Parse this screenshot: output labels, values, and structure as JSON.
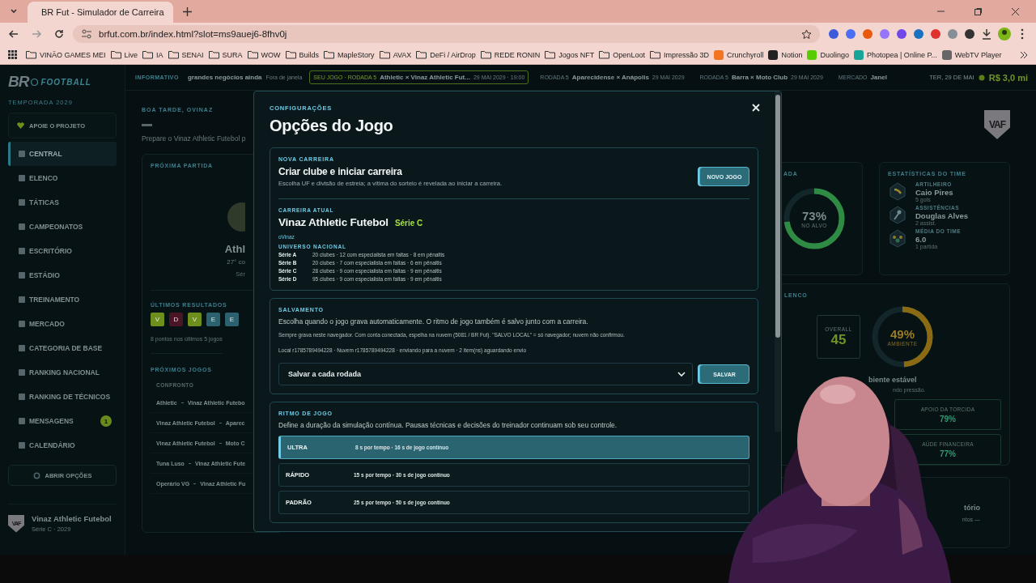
{
  "browser": {
    "tab_title": "BR Fut - Simulador de Carreira",
    "url": "brfut.com.br/index.html?slot=ms9auej6-8fhv0j",
    "bookmarks": [
      {
        "label": "VINÃO GAMES MEI",
        "kind": "folder"
      },
      {
        "label": "Live",
        "kind": "folder"
      },
      {
        "label": "IA",
        "kind": "folder"
      },
      {
        "label": "SENAI",
        "kind": "folder"
      },
      {
        "label": "SURA",
        "kind": "folder"
      },
      {
        "label": "WOW",
        "kind": "folder"
      },
      {
        "label": "Builds",
        "kind": "folder"
      },
      {
        "label": "MapleStory",
        "kind": "folder"
      },
      {
        "label": "AVAX",
        "kind": "folder"
      },
      {
        "label": "DeFi / AirDrop",
        "kind": "folder"
      },
      {
        "label": "REDE RONIN",
        "kind": "folder"
      },
      {
        "label": "Jogos NFT",
        "kind": "folder"
      },
      {
        "label": "OpenLoot",
        "kind": "folder"
      },
      {
        "label": "Impressão 3D",
        "kind": "folder"
      },
      {
        "label": "Crunchyroll",
        "kind": "site",
        "color": "#f47521"
      },
      {
        "label": "Notion",
        "kind": "site",
        "color": "#222222"
      },
      {
        "label": "Duolingo",
        "kind": "site",
        "color": "#58cc02"
      },
      {
        "label": "Photopea | Online P...",
        "kind": "site",
        "color": "#18a497"
      },
      {
        "label": "WebTV Player",
        "kind": "site",
        "color": "#666666"
      }
    ]
  },
  "sidebar": {
    "logo_mark": "BR",
    "logo_text": "FOOTBALL",
    "season": "TEMPORADA 2029",
    "support": "APOIE O PROJETO",
    "nav": [
      {
        "label": "CENTRAL",
        "selected": true
      },
      {
        "label": "ELENCO",
        "selected": false
      },
      {
        "label": "TÁTICAS",
        "selected": false
      },
      {
        "label": "CAMPEONATOS",
        "selected": false
      },
      {
        "label": "ESCRITÓRIO",
        "selected": false
      },
      {
        "label": "ESTÁDIO",
        "selected": false
      },
      {
        "label": "TREINAMENTO",
        "selected": false
      },
      {
        "label": "MERCADO",
        "selected": false
      },
      {
        "label": "CATEGORIA DE BASE",
        "selected": false
      },
      {
        "label": "RANKING NACIONAL",
        "selected": false
      },
      {
        "label": "RANKING DE TÉCNICOS",
        "selected": false
      },
      {
        "label": "MENSAGENS",
        "selected": false,
        "badge": "1"
      },
      {
        "label": "CALENDÁRIO",
        "selected": false
      }
    ],
    "options_button": "ABRIR OPÇÕES",
    "club": {
      "crest": "VAF",
      "name": "Vinaz Athletic Futebol",
      "subtitle": "Série C · 2029"
    }
  },
  "ticker": {
    "label": "INFORMATIVO",
    "items": [
      {
        "kind": "news",
        "title": "grandes negócios ainda",
        "note": "Fora de janela"
      },
      {
        "kind": "match",
        "tag": "SEU JOGO · RODADA 5",
        "title": "Athletic × Vinaz Athletic Fut...",
        "note": "29 MAI 2029 · 19:00",
        "highlighted": true
      },
      {
        "kind": "match",
        "tag": "RODADA 5",
        "title": "Aparecidense × Anápolis",
        "note": "29 MAI 2029",
        "highlighted": false
      },
      {
        "kind": "match",
        "tag": "RODADA 5",
        "title": "Barra × Moto Club",
        "note": "29 MAI 2029",
        "highlighted": false
      },
      {
        "kind": "match",
        "tag": "MERCADO",
        "title": "Janel",
        "highlighted": false
      }
    ],
    "date": "TER, 29 DE MAI",
    "balance": "R$ 3,0 mi"
  },
  "dashboard": {
    "greeting": "BOA TARDE, OVINAZ",
    "intro": "Prepare o Vinaz Athletic Futebol p",
    "next_match": {
      "title": "PRÓXIMA PARTIDA",
      "team": "Athl",
      "position": "27° co",
      "league": "Sér"
    },
    "results": {
      "title": "ÚLTIMOS RESULTADOS",
      "items": [
        {
          "label": "V",
          "color": "#6f8f1c"
        },
        {
          "label": "D",
          "color": "#4a1626"
        },
        {
          "label": "V",
          "color": "#6f8f1c"
        },
        {
          "label": "E",
          "color": "#2c6270"
        },
        {
          "label": "E",
          "color": "#2c6270"
        }
      ],
      "summary": "8 pontos nos últimos 5 jogos"
    },
    "upcoming": {
      "title": "PRÓXIMOS JOGOS",
      "column": "CONFRONTO",
      "rows": [
        {
          "home": "Athletic",
          "away": "Vinaz Athletic Futebo"
        },
        {
          "home": "Vinaz Athletic Futebol",
          "away": "Aparec"
        },
        {
          "home": "Vinaz Athletic Futebol",
          "away": "Moto C"
        },
        {
          "home": "Tuna Luso",
          "away": "Vinaz Athletic Fute"
        },
        {
          "home": "Operário VG",
          "away": "Vinaz Athletic Fu"
        }
      ]
    },
    "crest": "VAF",
    "shots": {
      "title": "ADA",
      "value": "73%",
      "caption": "NO ALVO",
      "level": 0.73
    },
    "team_stats": {
      "title": "ESTATÍSTICAS DO TIME",
      "items": [
        {
          "label": "ARTILHEIRO",
          "value": "Caio Pires",
          "detail": "5 gols"
        },
        {
          "label": "ASSISTÊNCIAS",
          "value": "Douglas Alves",
          "detail": "2 assist."
        },
        {
          "label": "MÉDIA DO TIME",
          "value": "6.0",
          "detail": "1 partida"
        }
      ]
    },
    "squad": {
      "title": "LENCO",
      "overall_label": "OVERALL",
      "overall": "45",
      "ambience": {
        "value": "49%",
        "caption": "AMBIENTE",
        "level": 0.49
      },
      "status": "biente estável",
      "status_detail": "ndo pressão.",
      "metrics": [
        {
          "label": "APOIO DA TORCIDA",
          "value": "79%"
        },
        {
          "label": "AÚDE FINANCEIRA",
          "value": "77%"
        }
      ]
    },
    "report": {
      "title": "tório",
      "text": "ntos —"
    }
  },
  "modal": {
    "eyebrow": "CONFIGURAÇÕES",
    "title": "Opções do Jogo",
    "new_career": {
      "section": "NOVA CARREIRA",
      "title": "Criar clube e iniciar carreira",
      "text": "Escolha UF e divisão de estreia; a vítima do sorteio é revelada ao iniciar a carreira.",
      "button": "NOVO JOGO"
    },
    "current": {
      "section": "CARREIRA ATUAL",
      "club": "Vinaz Athletic Futebol",
      "division": "Série C",
      "manager": "oVinaz",
      "universe": "UNIVERSO NACIONAL",
      "divisions": [
        {
          "name": "Série A",
          "info": "20 clubes · 12 com especialista em faltas · 8 em pênaltis"
        },
        {
          "name": "Série B",
          "info": "20 clubes · 7 com especialista em faltas · 6 em pênaltis"
        },
        {
          "name": "Série C",
          "info": "28 clubes · 9 com especialista em faltas · 9 em pênaltis"
        },
        {
          "name": "Série D",
          "info": "95 clubes · 9 com especialista em faltas · 9 em pênaltis"
        }
      ]
    },
    "save": {
      "section": "SALVAMENTO",
      "text": "Escolha quando o jogo grava automaticamente. O ritmo de jogo também é salvo junto com a carreira.",
      "note": "Sempre grava neste navegador. Com conta conectada, espelha na nuvem (5081 / BR Fut). \"SALVO LOCAL\" = só navegador; nuvem não confirmou.",
      "status": "Local r1785789494228 · Nuvem r1785789494228 · enviando para a nuvem · 2 item(ns) aguardando envio",
      "select": "Salvar a cada rodada",
      "button": "SALVAR"
    },
    "pace": {
      "section": "RITMO DE JOGO",
      "text": "Define a duração da simulação contínua. Pausas técnicas e decisões do treinador continuam sob seu controle.",
      "options": [
        {
          "label": "ULTRA",
          "detail": "8 s por tempo · 16 s de jogo contínuo",
          "selected": true
        },
        {
          "label": "RÁPIDO",
          "detail": "15 s por tempo · 30 s de jogo contínuo",
          "selected": false
        },
        {
          "label": "PADRÃO",
          "detail": "25 s por tempo · 50 s de jogo contínuo",
          "selected": false
        }
      ]
    }
  }
}
